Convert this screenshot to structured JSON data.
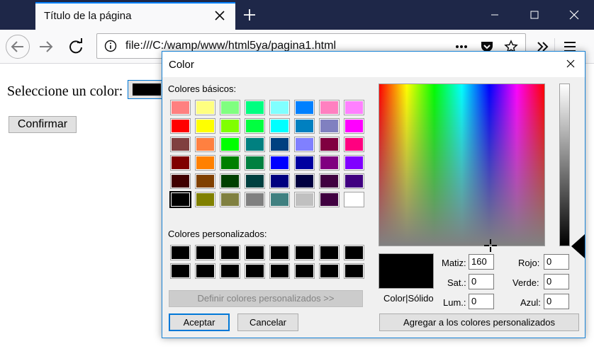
{
  "browser": {
    "tab_title": "Título de la página",
    "url": "file:///C:/wamp/www/html5ya/pagina1.html"
  },
  "page": {
    "label": "Seleccione un color:",
    "confirm_label": "Confirmar",
    "color_value": "#000000"
  },
  "dialog": {
    "title": "Color",
    "basic_colors_label": "Colores básicos:",
    "custom_colors_label": "Colores personalizados:",
    "basic_colors": [
      "#ff8080",
      "#ffff80",
      "#80ff80",
      "#00ff80",
      "#80ffff",
      "#0080ff",
      "#ff80c0",
      "#ff80ff",
      "#ff0000",
      "#ffff00",
      "#80ff00",
      "#00ff40",
      "#00ffff",
      "#0080c0",
      "#8080c0",
      "#ff00ff",
      "#804040",
      "#ff8040",
      "#00ff00",
      "#008080",
      "#004080",
      "#8080ff",
      "#800040",
      "#ff0080",
      "#800000",
      "#ff8000",
      "#008000",
      "#008040",
      "#0000ff",
      "#0000a0",
      "#800080",
      "#8000ff",
      "#400000",
      "#804000",
      "#004000",
      "#004040",
      "#000080",
      "#000040",
      "#400040",
      "#400080",
      "#000000",
      "#808000",
      "#808040",
      "#808080",
      "#408080",
      "#c0c0c0",
      "#400040",
      "#ffffff"
    ],
    "selected_basic_index": 40,
    "custom_colors": [
      "#000000",
      "#000000",
      "#000000",
      "#000000",
      "#000000",
      "#000000",
      "#000000",
      "#000000",
      "#000000",
      "#000000",
      "#000000",
      "#000000",
      "#000000",
      "#000000",
      "#000000",
      "#000000"
    ],
    "define_custom_label": "Definir colores personalizados >>",
    "ok_label": "Aceptar",
    "cancel_label": "Cancelar",
    "preview_label": "Color|Sólido",
    "add_custom_label": "Agregar a los colores personalizados",
    "hue_label": "Matiz:",
    "hue_value": "160",
    "sat_label": "Sat.:",
    "sat_value": "0",
    "lum_label": "Lum.:",
    "lum_value": "0",
    "red_label": "Rojo:",
    "red_value": "0",
    "green_label": "Verde:",
    "green_value": "0",
    "blue_label": "Azul:",
    "blue_value": "0"
  }
}
